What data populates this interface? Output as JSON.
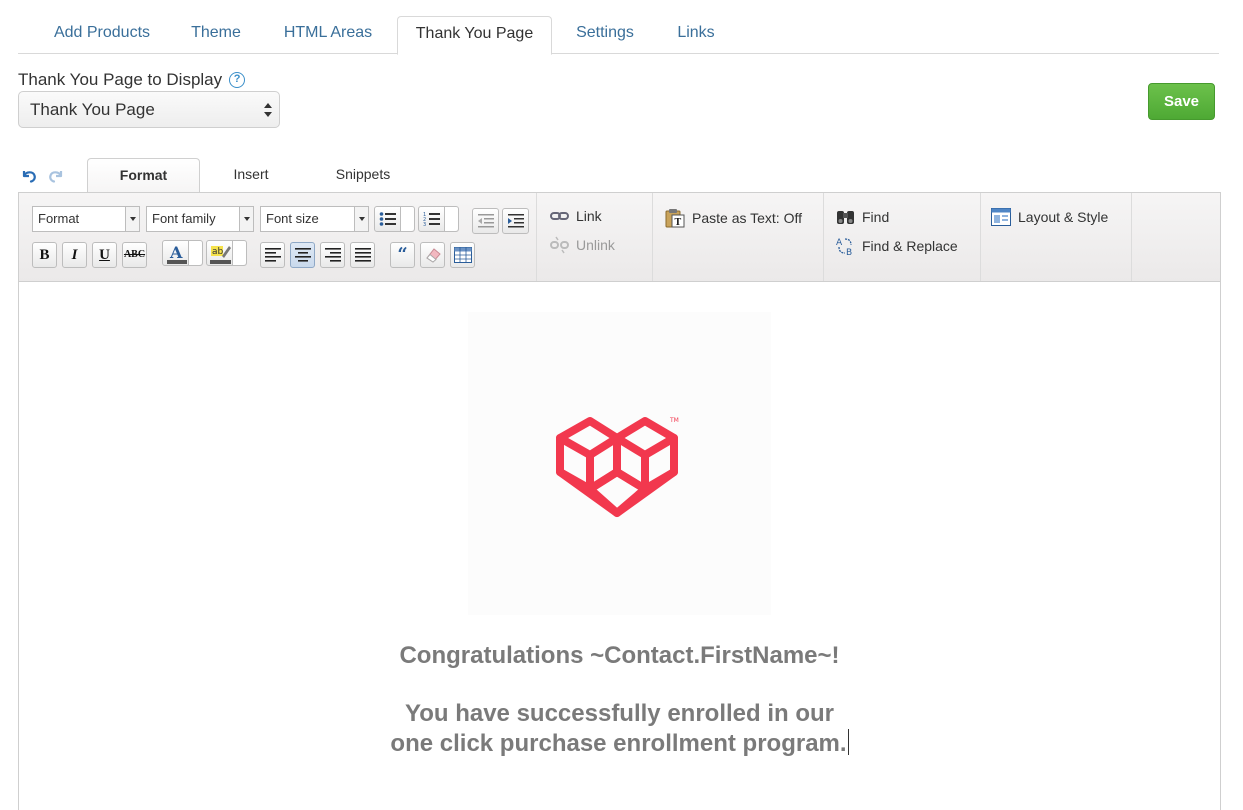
{
  "tabs": [
    {
      "label": "Add Products"
    },
    {
      "label": "Theme"
    },
    {
      "label": "HTML Areas"
    },
    {
      "label": "Thank You Page"
    },
    {
      "label": "Settings"
    },
    {
      "label": "Links"
    }
  ],
  "active_tab": "Thank You Page",
  "display": {
    "label": "Thank You Page to Display",
    "selected": "Thank You Page"
  },
  "save_label": "Save",
  "editor_tabs": [
    {
      "label": "Format"
    },
    {
      "label": "Insert"
    },
    {
      "label": "Snippets"
    }
  ],
  "toolbar": {
    "format_dd": "Format",
    "font_family_dd": "Font family",
    "font_size_dd": "Font size",
    "bold": "B",
    "italic": "I",
    "underline": "U",
    "strike": "ABC",
    "link": "Link",
    "unlink": "Unlink",
    "paste_as_text": "Paste as Text: Off",
    "find": "Find",
    "find_replace": "Find & Replace",
    "layout_style": "Layout & Style"
  },
  "content": {
    "line1": "Congratulations ~Contact.FirstName~!",
    "line2": "You have successfully enrolled in our",
    "line3": "one click purchase enrollment program."
  },
  "colors": {
    "accent_blue": "#3a6f9a",
    "save_green": "#5cb540",
    "logo_red": "#f2384e",
    "message_gray": "#7a7a7a"
  }
}
